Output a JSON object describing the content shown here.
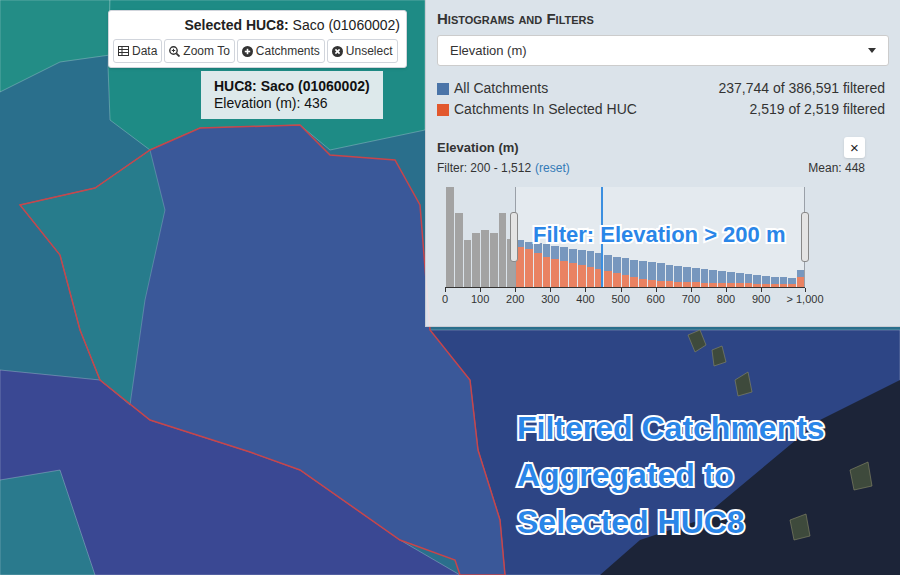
{
  "selected_huc": {
    "label": "Selected HUC8:",
    "value": "Saco (01060002)",
    "buttons": [
      {
        "label": "Data"
      },
      {
        "label": "Zoom To"
      },
      {
        "label": "Catchments"
      },
      {
        "label": "Unselect"
      }
    ]
  },
  "tooltip": {
    "title": "HUC8: Saco (01060002)",
    "label": "Elevation (m):",
    "value": "436"
  },
  "filters_panel": {
    "title": "Histograms and Filters",
    "dropdown": {
      "value": "Elevation (m)"
    },
    "legend": [
      {
        "label": "All Catchments",
        "count": "237,744 of 386,591 filtered",
        "color": "#4a74a8"
      },
      {
        "label": "Catchments In Selected HUC",
        "count": "2,519 of 2,519 filtered",
        "color": "#e2582e"
      }
    ],
    "chart": {
      "title": "Elevation (m)",
      "close": "×",
      "filter_text": "Filter: 200 - 1,512",
      "reset": "(reset)",
      "mean_text": "Mean: 448",
      "mean_value": 448,
      "bin_width": 25,
      "brush": {
        "from": 200,
        "to": 1025
      },
      "ticks": [
        {
          "label": "0",
          "value": 0
        },
        {
          "label": "100",
          "value": 100
        },
        {
          "label": "200",
          "value": 200
        },
        {
          "label": "300",
          "value": 300
        },
        {
          "label": "400",
          "value": 400
        },
        {
          "label": "500",
          "value": 500
        },
        {
          "label": "600",
          "value": 600
        },
        {
          "label": "700",
          "value": 700
        },
        {
          "label": "800",
          "value": 800
        },
        {
          "label": "900",
          "value": 900
        },
        {
          "label": "> 1,000",
          "value": 1025
        }
      ],
      "series": [
        {
          "color": "#4a74a8",
          "values": [
            100,
            74,
            47,
            54,
            57,
            54,
            74,
            48,
            47,
            45,
            44,
            43,
            41,
            40,
            38,
            37,
            36,
            34,
            32,
            30,
            29,
            27,
            26,
            25,
            24,
            22,
            21,
            20,
            19,
            18,
            17,
            16,
            15,
            14,
            13,
            12,
            11,
            10,
            10,
            9,
            17
          ]
        },
        {
          "color": "#e2582e",
          "values": [
            0,
            0,
            0,
            0,
            0,
            0,
            0,
            0,
            40,
            38,
            34,
            30,
            28,
            26,
            24,
            22,
            20,
            18,
            16,
            14,
            12,
            10,
            8,
            7,
            6,
            6,
            5,
            5,
            5,
            4,
            4,
            4,
            4,
            4,
            4,
            3,
            3,
            3,
            3,
            3,
            10
          ]
        }
      ]
    }
  },
  "annotations": {
    "chart_note": "Filter: Elevation > 200 m",
    "map_note": [
      "Filtered Catchments",
      "Aggregated to",
      "Selected HUC8"
    ]
  }
}
